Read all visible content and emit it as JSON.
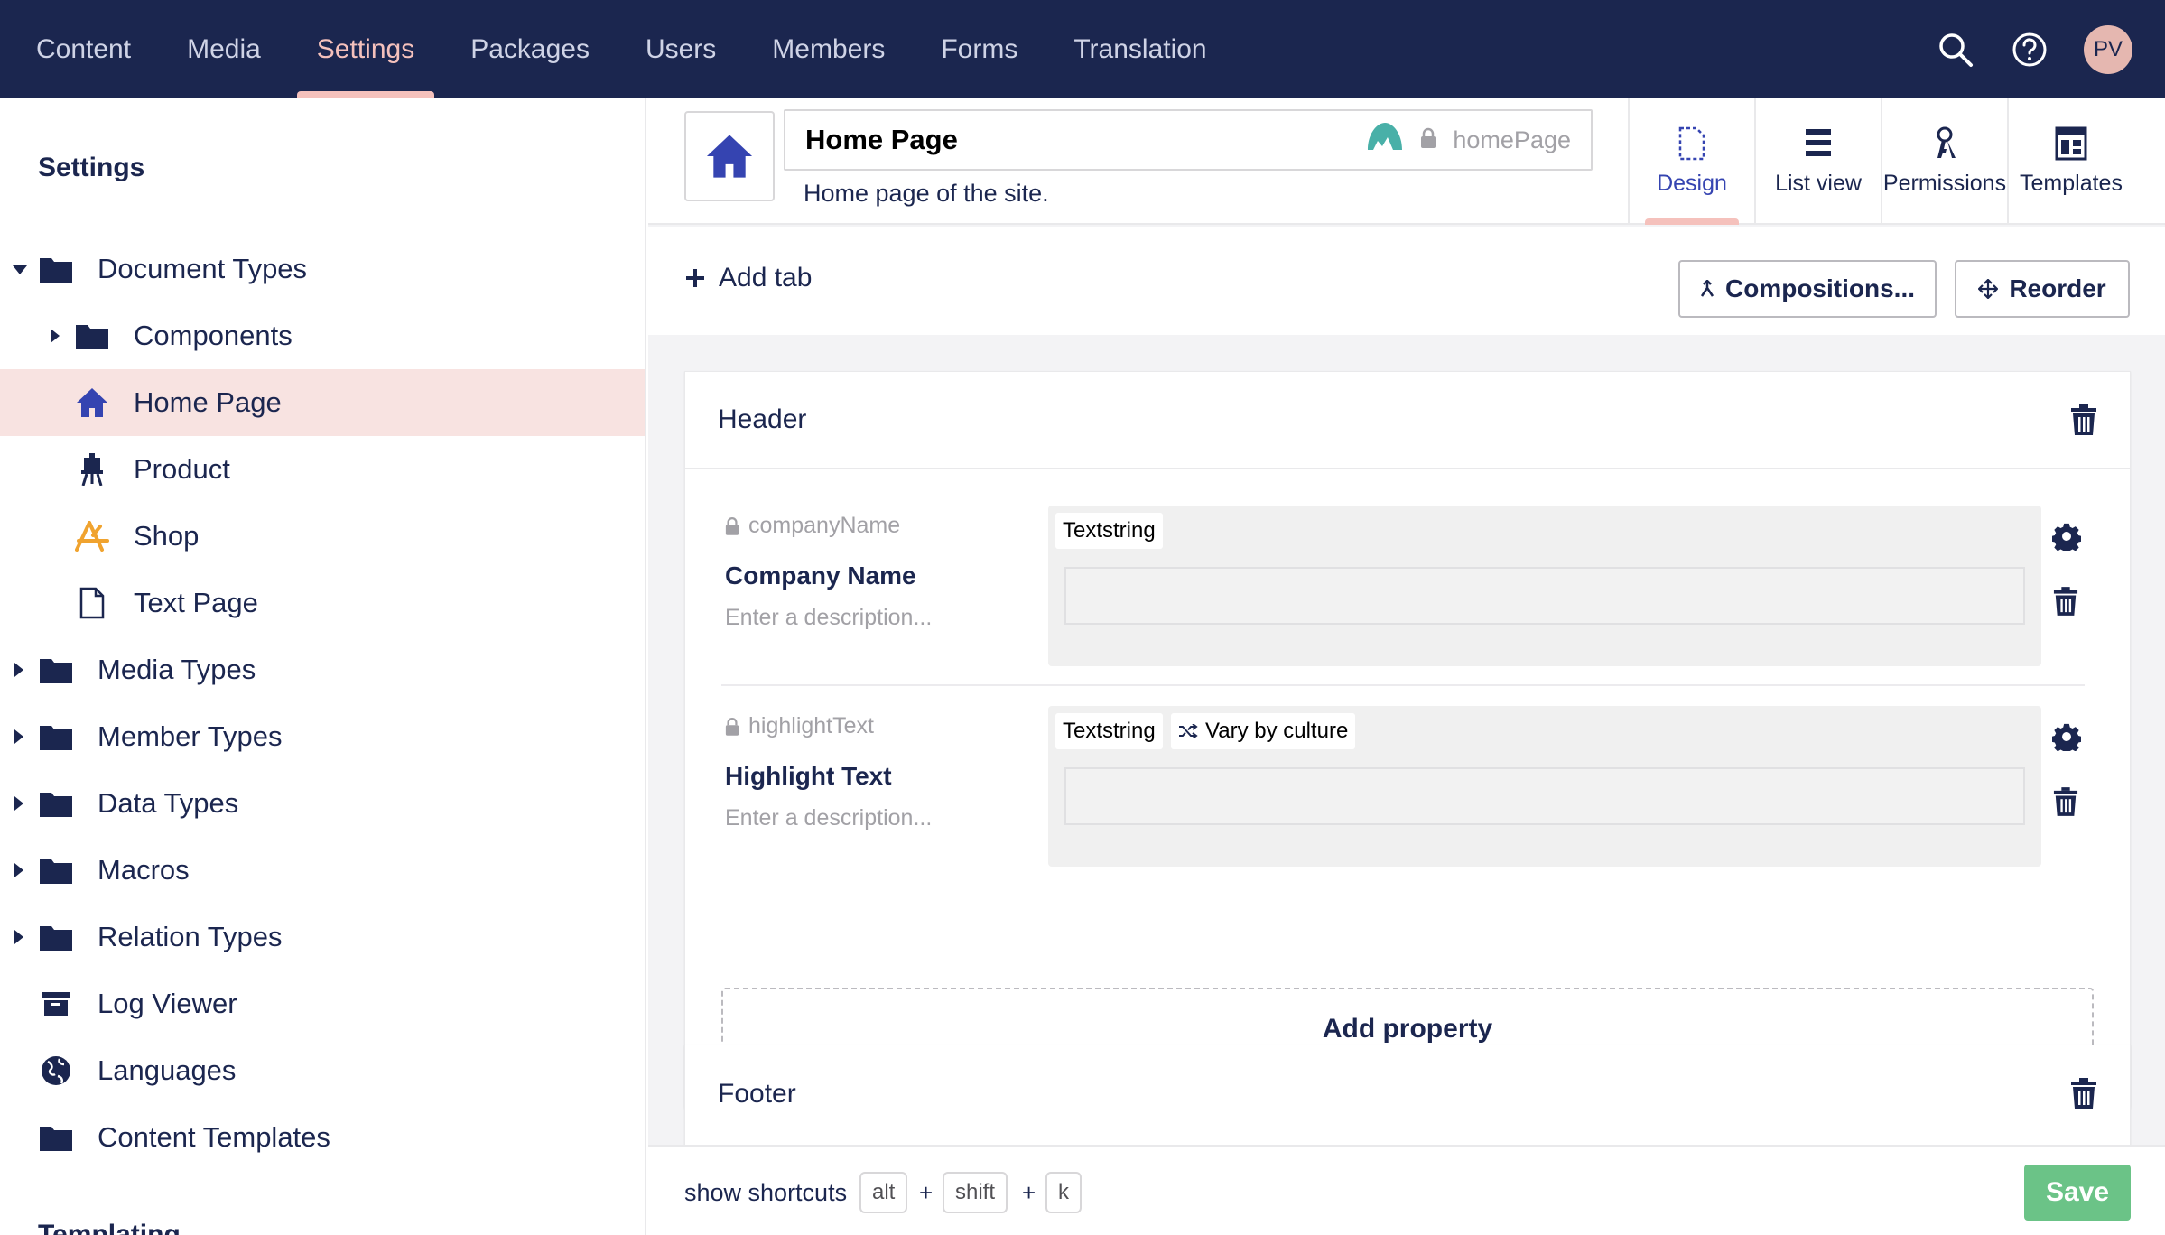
{
  "topnav": {
    "items": [
      {
        "label": "Content",
        "active": false
      },
      {
        "label": "Media",
        "active": false
      },
      {
        "label": "Settings",
        "active": true
      },
      {
        "label": "Packages",
        "active": false
      },
      {
        "label": "Users",
        "active": false
      },
      {
        "label": "Members",
        "active": false
      },
      {
        "label": "Forms",
        "active": false
      },
      {
        "label": "Translation",
        "active": false
      }
    ],
    "icons": [
      "search-icon",
      "help-icon"
    ],
    "avatar_initials": "PV"
  },
  "sidebar": {
    "title": "Settings",
    "tree": [
      {
        "label": "Document Types",
        "icon": "folder-icon",
        "expanded": true
      },
      {
        "label": "Components",
        "icon": "folder-icon",
        "expanded": false
      },
      {
        "label": "Home Page",
        "icon": "home-icon",
        "selected": true
      },
      {
        "label": "Product",
        "icon": "easel-icon"
      },
      {
        "label": "Shop",
        "icon": "shop-icon"
      },
      {
        "label": "Text Page",
        "icon": "document-icon"
      },
      {
        "label": "Media Types",
        "icon": "folder-icon",
        "expanded": false
      },
      {
        "label": "Member Types",
        "icon": "folder-icon",
        "expanded": false
      },
      {
        "label": "Data Types",
        "icon": "folder-icon",
        "expanded": false
      },
      {
        "label": "Macros",
        "icon": "folder-icon",
        "expanded": false
      },
      {
        "label": "Relation Types",
        "icon": "folder-icon",
        "expanded": false
      },
      {
        "label": "Log Viewer",
        "icon": "archive-icon"
      },
      {
        "label": "Languages",
        "icon": "globe-icon"
      },
      {
        "label": "Content Templates",
        "icon": "folder-icon"
      }
    ],
    "section_below": "Templating"
  },
  "editor": {
    "name": "Home Page",
    "alias": "homePage",
    "description": "Home page of the site.",
    "tabs": [
      {
        "label": "Design",
        "icon": "design-icon",
        "active": true
      },
      {
        "label": "List view",
        "icon": "list-view-icon",
        "active": false
      },
      {
        "label": "Permissions",
        "icon": "permissions-icon",
        "active": false
      },
      {
        "label": "Templates",
        "icon": "templates-icon",
        "active": false
      }
    ]
  },
  "toolbar": {
    "add_tab": "Add tab",
    "compositions": "Compositions...",
    "reorder": "Reorder"
  },
  "groups": [
    {
      "name": "Header",
      "properties": [
        {
          "alias": "companyName",
          "name": "Company Name",
          "description": "Enter a description...",
          "editor": "Textstring",
          "vary": ""
        },
        {
          "alias": "highlightText",
          "name": "Highlight Text",
          "description": "Enter a description...",
          "editor": "Textstring",
          "vary": "Vary by culture"
        }
      ],
      "add_property": "Add property"
    },
    {
      "name": "Footer"
    }
  ],
  "footer": {
    "shortcuts_label": "show shortcuts",
    "keys": [
      "alt",
      "shift",
      "k"
    ],
    "plus": "+",
    "save": "Save"
  },
  "colors": {
    "nav_bg": "#1b264f",
    "accent": "#f5c1bc",
    "selected_bg": "#f8e3e1",
    "save_green": "#6bc387",
    "icon_blue": "#3544b1",
    "shop_orange": "#f0a32f"
  }
}
